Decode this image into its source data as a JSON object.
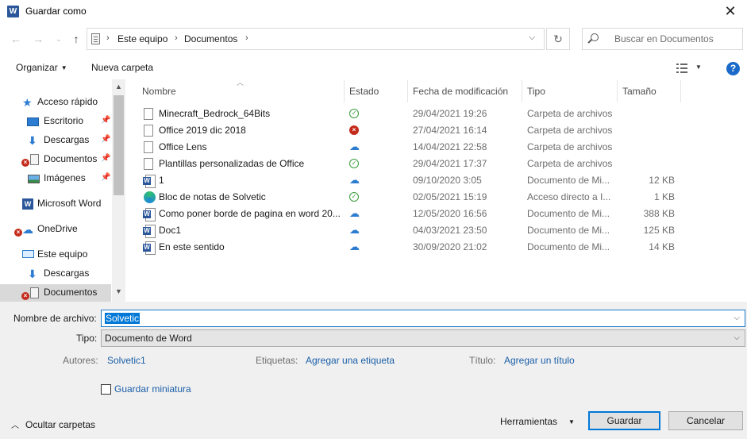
{
  "window": {
    "title": "Guardar como",
    "logo": "W"
  },
  "address": {
    "crumbs": [
      "Este equipo",
      "Documentos"
    ],
    "search_placeholder": "Buscar en Documentos"
  },
  "toolbar": {
    "organize": "Organizar",
    "new_folder": "Nueva carpeta"
  },
  "nav": {
    "items": [
      {
        "label": "Acceso rápido",
        "icon": "star-icon"
      },
      {
        "label": "Escritorio",
        "icon": "desktop-icon",
        "pinned": true
      },
      {
        "label": "Descargas",
        "icon": "download-icon",
        "pinned": true
      },
      {
        "label": "Documentos",
        "icon": "document-icon",
        "pinned": true,
        "error": true
      },
      {
        "label": "Imágenes",
        "icon": "pictures-icon",
        "pinned": true
      },
      {
        "label": "Microsoft Word",
        "icon": "word-icon"
      },
      {
        "label": "OneDrive",
        "icon": "cloud-icon",
        "error": true
      },
      {
        "label": "Este equipo",
        "icon": "computer-icon"
      },
      {
        "label": "Descargas",
        "icon": "download-icon"
      },
      {
        "label": "Documentos",
        "icon": "document-icon",
        "error": true,
        "selected": true
      }
    ]
  },
  "columns": {
    "name": "Nombre",
    "status": "Estado",
    "modified": "Fecha de modificación",
    "type": "Tipo",
    "size": "Tamaño"
  },
  "files": [
    {
      "name": "Minecraft_Bedrock_64Bits",
      "status": "ok",
      "date": "29/04/2021 19:26",
      "type": "Carpeta de archivos",
      "size": "",
      "icon": "file"
    },
    {
      "name": "Office 2019 dic 2018",
      "status": "error",
      "date": "27/04/2021 16:14",
      "type": "Carpeta de archivos",
      "size": "",
      "icon": "file"
    },
    {
      "name": "Office Lens",
      "status": "cloud",
      "date": "14/04/2021 22:58",
      "type": "Carpeta de archivos",
      "size": "",
      "icon": "file"
    },
    {
      "name": "Plantillas personalizadas de Office",
      "status": "ok",
      "date": "29/04/2021 17:37",
      "type": "Carpeta de archivos",
      "size": "",
      "icon": "file"
    },
    {
      "name": "1",
      "status": "cloud",
      "date": "09/10/2020 3:05",
      "type": "Documento de Mi...",
      "size": "12 KB",
      "icon": "word"
    },
    {
      "name": "Bloc de notas de Solvetic",
      "status": "ok",
      "date": "02/05/2021 15:19",
      "type": "Acceso directo a I...",
      "size": "1 KB",
      "icon": "edge"
    },
    {
      "name": "Como poner borde de pagina en word 20...",
      "status": "cloud",
      "date": "12/05/2020 16:56",
      "type": "Documento de Mi...",
      "size": "388 KB",
      "icon": "word"
    },
    {
      "name": "Doc1",
      "status": "cloud",
      "date": "04/03/2021 23:50",
      "type": "Documento de Mi...",
      "size": "125 KB",
      "icon": "word"
    },
    {
      "name": "En este sentido",
      "status": "cloud",
      "date": "30/09/2020 21:02",
      "type": "Documento de Mi...",
      "size": "14 KB",
      "icon": "word"
    }
  ],
  "form": {
    "filename_label": "Nombre de archivo:",
    "filename_value": "Solvetic",
    "type_label": "Tipo:",
    "type_value": "Documento de Word",
    "authors_label": "Autores:",
    "authors_value": "Solvetic1",
    "tags_label": "Etiquetas:",
    "tags_value": "Agregar una etiqueta",
    "title_label": "Título:",
    "title_value": "Agregar un título",
    "thumbnail_label": "Guardar miniatura"
  },
  "footer": {
    "hide_folders": "Ocultar carpetas",
    "tools": "Herramientas",
    "save": "Guardar",
    "cancel": "Cancelar"
  }
}
